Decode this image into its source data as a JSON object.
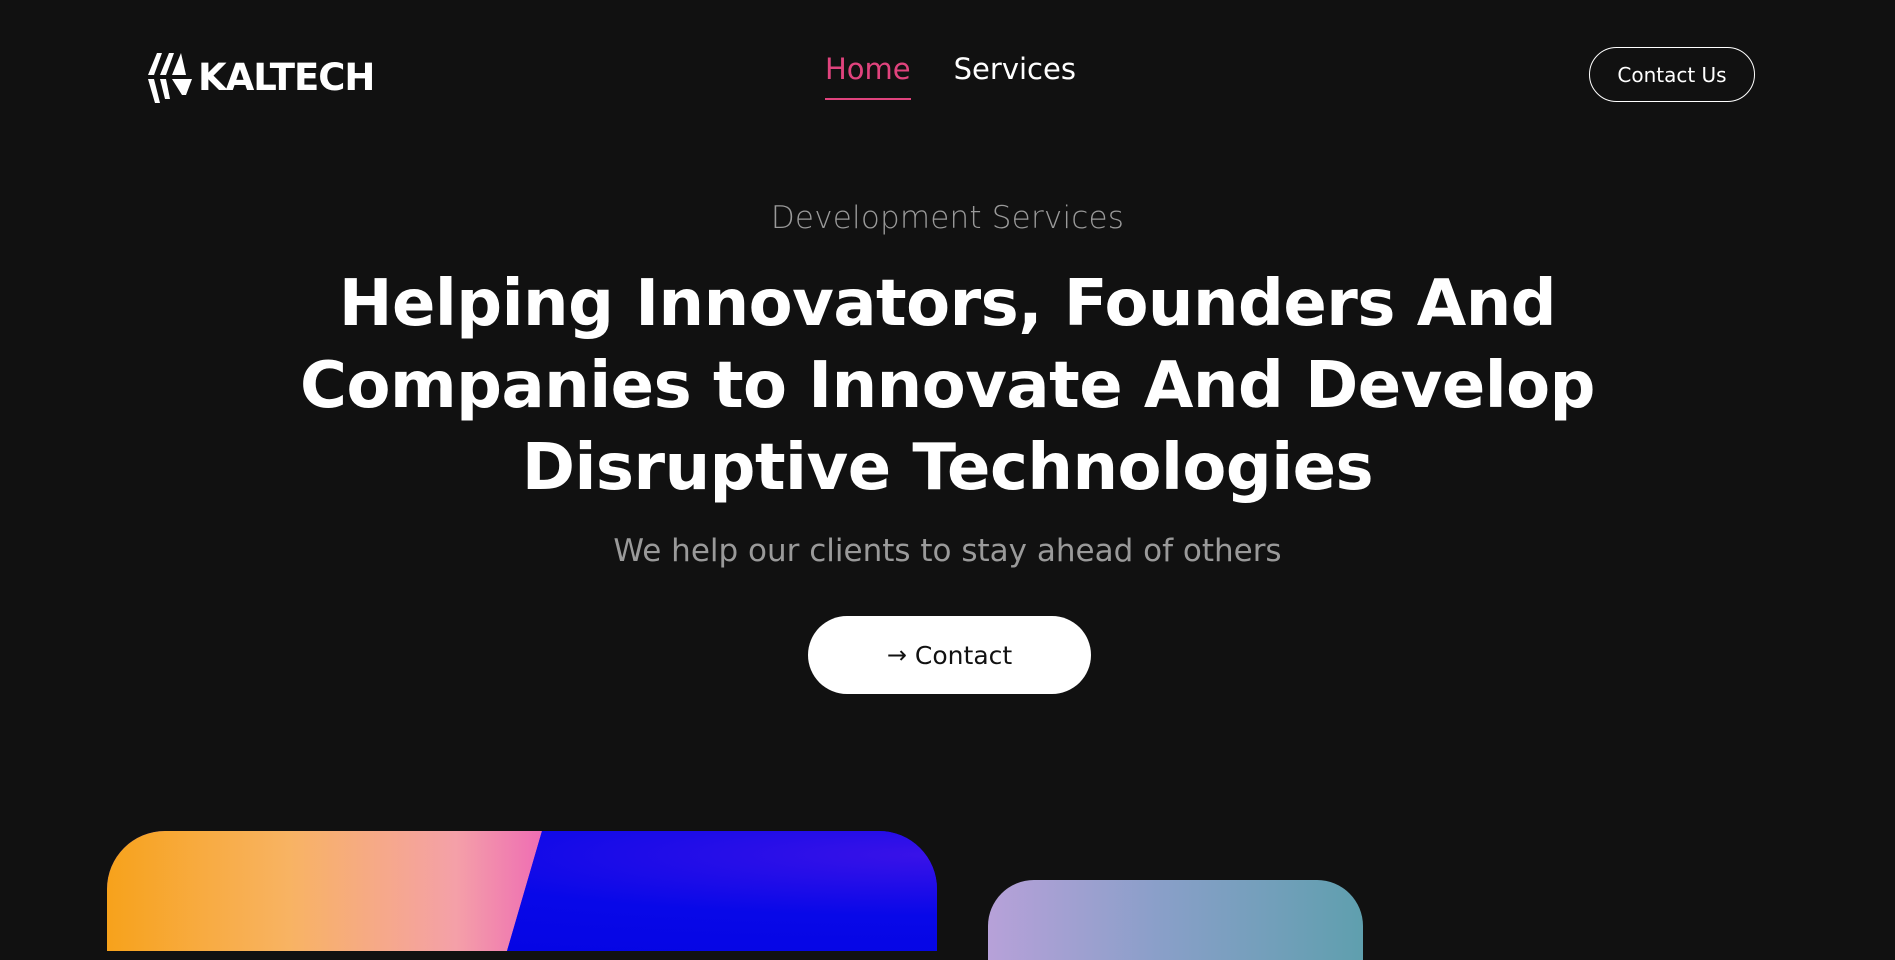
{
  "brand": {
    "name": "KALTECH",
    "logo_icon": "kaltech-logo-mark",
    "accent_color": "#e0437d",
    "background_color": "#111111"
  },
  "nav": {
    "items": [
      {
        "label": "Home",
        "active": true
      },
      {
        "label": "Services",
        "active": false
      }
    ]
  },
  "header": {
    "cta_label": "Contact Us"
  },
  "hero": {
    "eyebrow": "Development Services",
    "headline_lines": [
      "Helping Innovators, Founders And",
      "Companies to Innovate And Develop",
      "Disruptive Technologies"
    ],
    "subtitle": "We help our clients to stay ahead of others",
    "cta_icon": "arrow-right-icon",
    "cta_label": "Contact"
  }
}
